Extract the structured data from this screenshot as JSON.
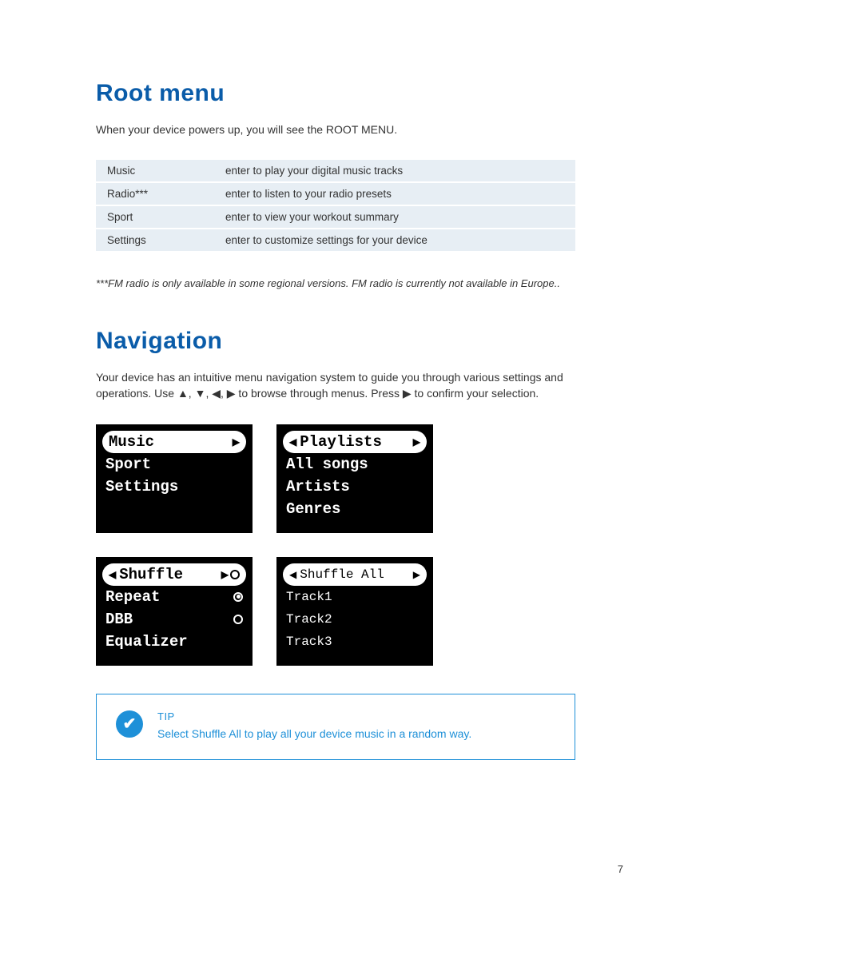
{
  "root_menu": {
    "heading": "Root menu",
    "intro": "When your device powers up, you will see the ROOT MENU.",
    "rows": [
      {
        "name": "Music",
        "desc": "enter to play your digital music tracks"
      },
      {
        "name": "Radio***",
        "desc": "enter to listen to your radio presets"
      },
      {
        "name": "Sport",
        "desc": "enter to view your workout summary"
      },
      {
        "name": "Settings",
        "desc": "enter to customize settings for your device"
      }
    ],
    "footnote": "***FM radio is only available in some regional versions. FM  radio is currently not available in Europe.."
  },
  "navigation": {
    "heading": "Navigation",
    "intro_a": "Your device has an intuitive menu navigation system to guide you through various settings and operations.  Use ",
    "intro_b": " to browse through menus. Press ",
    "intro_c": " to confirm your selection.",
    "arrows": "▲, ▼, ◀, ▶",
    "arrow_right": "▶",
    "screens": {
      "screen1": {
        "selected": "Music",
        "items": [
          "Sport",
          "Settings"
        ]
      },
      "screen2": {
        "selected": "Playlists",
        "items": [
          "All songs",
          "Artists",
          "Genres"
        ]
      },
      "screen3": {
        "selected": "Shuffle",
        "items": [
          "Repeat",
          "DBB",
          "Equalizer"
        ]
      },
      "screen4": {
        "selected": "Shuffle All",
        "items": [
          "Track1",
          "Track2",
          "Track3"
        ]
      }
    }
  },
  "tip": {
    "label": "TIP",
    "text": "Select Shuffle All to play all your device music in a random way."
  },
  "page_number": "7"
}
